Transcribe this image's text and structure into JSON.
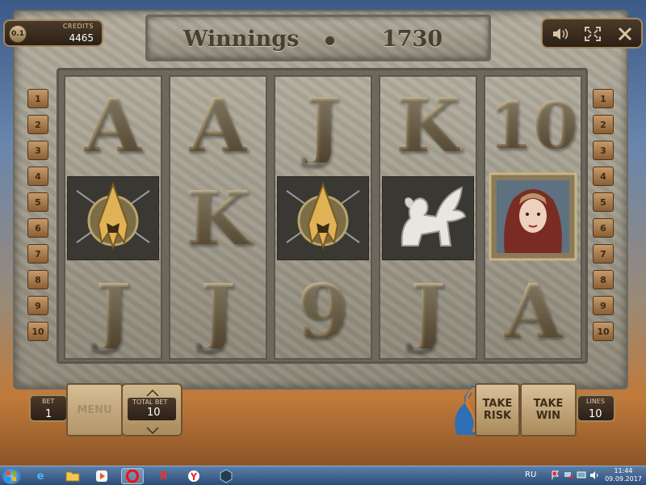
{
  "header": {
    "denomination": "0.1",
    "credits_label": "CREDITS",
    "credits_value": "4465",
    "winnings_label": "Winnings",
    "winnings_value": "1730"
  },
  "controls": {
    "sound_icon": "speaker-icon",
    "fullscreen_icon": "fullscreen-icon",
    "close_icon": "close-icon"
  },
  "reels": [
    {
      "top": "A",
      "middle": "spartan-helmet",
      "bottom": "J"
    },
    {
      "top": "A",
      "middle": "K",
      "bottom": "J"
    },
    {
      "top": "J",
      "middle": "spartan-helmet",
      "bottom": "9"
    },
    {
      "top": "K",
      "middle": "griffin-statue",
      "bottom": "J"
    },
    {
      "top": "10",
      "middle": "hooded-woman",
      "bottom": "A"
    }
  ],
  "line_numbers": [
    "1",
    "2",
    "3",
    "4",
    "5",
    "6",
    "7",
    "8",
    "9",
    "10"
  ],
  "bottom": {
    "bet_label": "BET",
    "bet_value": "1",
    "menu_label": "MENU",
    "total_bet_label": "TOTAL BET",
    "total_bet_value": "10",
    "take_risk_label": "TAKE RISK",
    "take_win_label": "TAKE WIN",
    "lines_label": "LINES",
    "lines_value": "10"
  },
  "taskbar": {
    "language": "RU",
    "time": "11:44",
    "date": "09.09.2017"
  },
  "colors": {
    "accent": "#a4885d",
    "stone": "#a8a393",
    "panel": "#3a2b1e"
  }
}
